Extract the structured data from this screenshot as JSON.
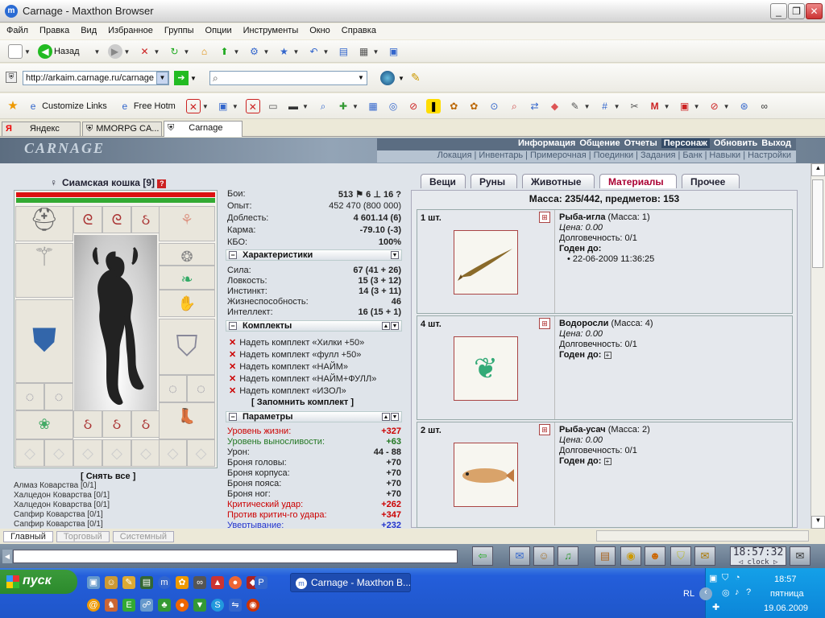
{
  "window": {
    "title": "Carnage - Maxthon Browser"
  },
  "menu": [
    "Файл",
    "Правка",
    "Вид",
    "Избранное",
    "Группы",
    "Опции",
    "Инструменты",
    "Окно",
    "Справка"
  ],
  "toolbar": {
    "back_label": "Назад"
  },
  "address": {
    "url": "http://arkaim.carnage.ru/carnage"
  },
  "links": {
    "customize": "Customize Links",
    "free": "Free Hotm"
  },
  "browser_tabs": [
    {
      "label": "Яндекс"
    },
    {
      "label": "MMORPG CA..."
    },
    {
      "label": "Carnage"
    }
  ],
  "game": {
    "logo": "CARNAGE",
    "nav1": [
      "Информация",
      "Общение",
      "Отчеты",
      "Персонаж",
      "Обновить",
      "Выход"
    ],
    "nav2": [
      "Локация",
      "|",
      "Инвентарь",
      "|",
      "Примерочная",
      "|",
      "Поединки",
      "|",
      "Задания",
      "|",
      "Банк",
      "|",
      "Навыки",
      "|",
      "Настройки"
    ],
    "character": {
      "name": "Сиамская кошка",
      "level": "[9]",
      "undress": "[ Снять все ]"
    },
    "gems": [
      "Алмаз Коварства [0/1]",
      "Халцедон Коварства [0/1]",
      "Халцедон Коварства [0/1]",
      "Сапфир Коварства [0/1]",
      "Сапфир Коварства [0/1]"
    ],
    "stats": [
      {
        "label": "Бои:",
        "value": "513 ⚑  6 ⊥  16 ?"
      },
      {
        "label": "Опыт:",
        "value": "452 470 (800 000)"
      },
      {
        "label": "Доблесть:",
        "value": "4 601.14 (6)"
      },
      {
        "label": "Карма:",
        "value": "-79.10 (-3)"
      },
      {
        "label": "КБО:",
        "value": "100%"
      }
    ],
    "sections": {
      "characteristics": "Характеристики",
      "kits": "Комплекты",
      "params": "Параметры"
    },
    "characteristics": [
      {
        "label": "Сила:",
        "value": "67 (41 + 26)"
      },
      {
        "label": "Ловкость:",
        "value": "15 (3 + 12)"
      },
      {
        "label": "Инстинкт:",
        "value": "14 (3 + 11)"
      },
      {
        "label": "Жизнеспособность:",
        "value": "46"
      },
      {
        "label": "Интеллект:",
        "value": "16 (15 + 1)"
      }
    ],
    "kits": [
      "Надеть комплект «Хилки +50»",
      "Надеть комплект «фулл +50»",
      "Надеть комплект «НАЙМ»",
      "Надеть комплект «НАЙМ+ФУЛЛ»",
      "Надеть комплект «ИЗОЛ»"
    ],
    "remember_kit": "[ Запомнить комплект ]",
    "params": [
      {
        "label": "Уровень жизни:",
        "value": "+327",
        "cls": "red"
      },
      {
        "label": "Уровень выносливости:",
        "value": "+63",
        "cls": "grn"
      },
      {
        "label": "Урон:",
        "value": "44 - 88",
        "cls": ""
      },
      {
        "label": "Броня головы:",
        "value": "+70",
        "cls": ""
      },
      {
        "label": "Броня корпуса:",
        "value": "+70",
        "cls": ""
      },
      {
        "label": "Броня пояса:",
        "value": "+70",
        "cls": ""
      },
      {
        "label": "Броня ног:",
        "value": "+70",
        "cls": ""
      },
      {
        "label": "Критический удар:",
        "value": "+262",
        "cls": "red"
      },
      {
        "label": "Против критич-го удара:",
        "value": "+347",
        "cls": "red"
      },
      {
        "label": "Увертывание:",
        "value": "+232",
        "cls": "blu"
      }
    ],
    "inv_tabs": [
      "Вещи",
      "Руны",
      "Животные",
      "Материалы",
      "Прочее"
    ],
    "mass": "Масса: 235/442, предметов: 153",
    "items": [
      {
        "count": "1 шт.",
        "name": "Рыба-игла",
        "mass": "(Масса: 1)",
        "price": "Цена: 0.00",
        "durability": "Долговечность: 0/1",
        "valid": "Годен до:",
        "date": "• 22-06-2009 11:36:25"
      },
      {
        "count": "4 шт.",
        "name": "Водоросли",
        "mass": "(Масса: 4)",
        "price": "Цена: 0.00",
        "durability": "Долговечность: 0/1",
        "valid": "Годен до:",
        "date": ""
      },
      {
        "count": "2 шт.",
        "name": "Рыба-усач",
        "mass": "(Масса: 2)",
        "price": "Цена: 0.00",
        "durability": "Долговечность: 0/1",
        "valid": "Годен до:",
        "date": ""
      }
    ],
    "chat_tabs": [
      "Главный",
      "Торговый",
      "Системный"
    ],
    "clock": "18:57:32",
    "clock_label": "◁ clock ▷"
  },
  "taskbar": {
    "start": "пуск",
    "task": "Carnage - Maxthon B...",
    "lang": "RL",
    "time": "18:57",
    "day": "пятница",
    "date": "19.06.2009"
  }
}
